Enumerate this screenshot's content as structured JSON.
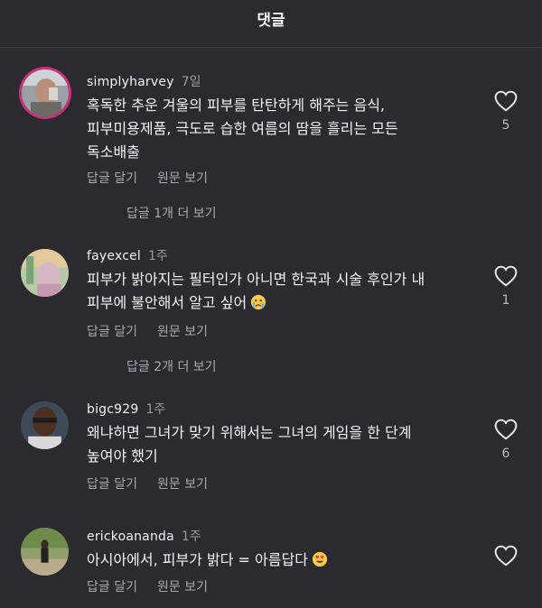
{
  "header": {
    "title": "댓글"
  },
  "comments": [
    {
      "username": "simplyharvey",
      "age": "7일",
      "lines": [
        "혹독한 추운 겨울의 피부를 탄탄하게 해주는 음식,",
        "피부미용제품, 극도로 습한 여름의 땀을 흘리는 모든",
        "독소배출"
      ],
      "reply_label": "답글 달기",
      "original_label": "원문 보기",
      "more_replies": "답글 1개 더 보기",
      "likes": "5"
    },
    {
      "username": "fayexcel",
      "age": "1주",
      "lines": [
        "피부가 밝아지는 필터인가 아니면 한국과 시술 후인가 내",
        "피부에 불안해서 알고 싶어"
      ],
      "emoji": "crying-face-emoji",
      "reply_label": "답글 달기",
      "original_label": "원문 보기",
      "more_replies": "답글 2개 더 보기",
      "likes": "1"
    },
    {
      "username": "bigc929",
      "age": "1주",
      "lines": [
        "왜냐하면 그녀가 맞기 위해서는 그녀의 게임을 한 단계",
        "높여야 했기"
      ],
      "reply_label": "답글 달기",
      "original_label": "원문 보기",
      "likes": "6"
    },
    {
      "username": "erickoananda",
      "age": "1주",
      "lines": [
        "아시아에서, 피부가 밝다 = 아름답다"
      ],
      "emoji": "heart-eyes-emoji",
      "reply_label": "답글 달기",
      "original_label": "원문 보기",
      "likes": ""
    }
  ],
  "colors": {
    "background": "#2b2b2f",
    "text": "#f2f2f2",
    "muted": "#a8a8ae",
    "story_ring": "#c9307a"
  }
}
